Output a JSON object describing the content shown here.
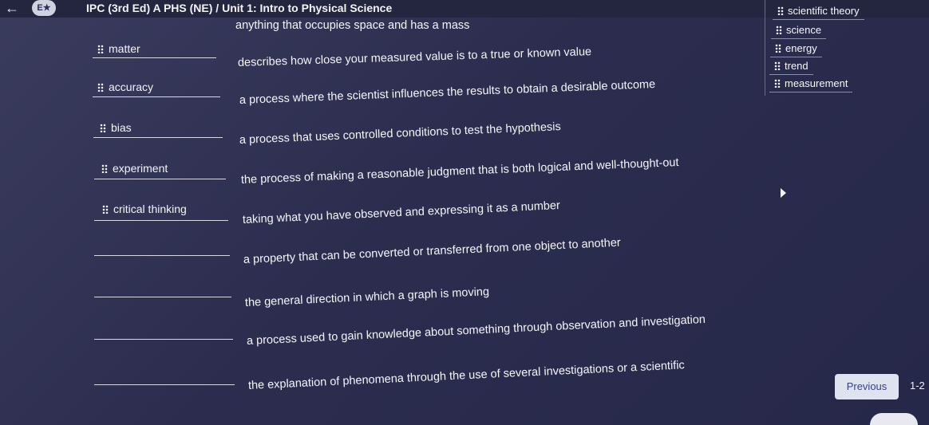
{
  "header": {
    "back_icon": "back-arrow-icon",
    "logo_text": "E★",
    "course_title": "IPC (3rd Ed) A PHS (NE) / Unit 1: Intro to Physical Science"
  },
  "matching": {
    "rows": [
      {
        "term": "matter",
        "definition": "anything that occupies space and has a mass"
      },
      {
        "term": "accuracy",
        "definition": "describes how close your measured value is to a true or known value"
      },
      {
        "term": "bias",
        "definition": "a process where the scientist influences the results to obtain a desirable outcome"
      },
      {
        "term": "experiment",
        "definition": "a process that uses controlled conditions to test the hypothesis"
      },
      {
        "term": "critical thinking",
        "definition": "the process of making a reasonable judgment that is both logical and well-thought-out"
      },
      {
        "term": "",
        "definition": "taking what you have observed and expressing it as a number"
      },
      {
        "term": "",
        "definition": "a property that can be converted or transferred from one object to another"
      },
      {
        "term": "",
        "definition": "the general direction in which a graph is moving"
      },
      {
        "term": "",
        "definition": "a process used to gain knowledge about something through observation and investigation"
      },
      {
        "term": "",
        "definition": "the explanation of phenomena through the use of several investigations or a scientific"
      }
    ]
  },
  "word_bank": [
    "scientific theory",
    "science",
    "energy",
    "trend",
    "measurement"
  ],
  "footer": {
    "previous_label": "Previous",
    "page_indicator": "1-2"
  }
}
